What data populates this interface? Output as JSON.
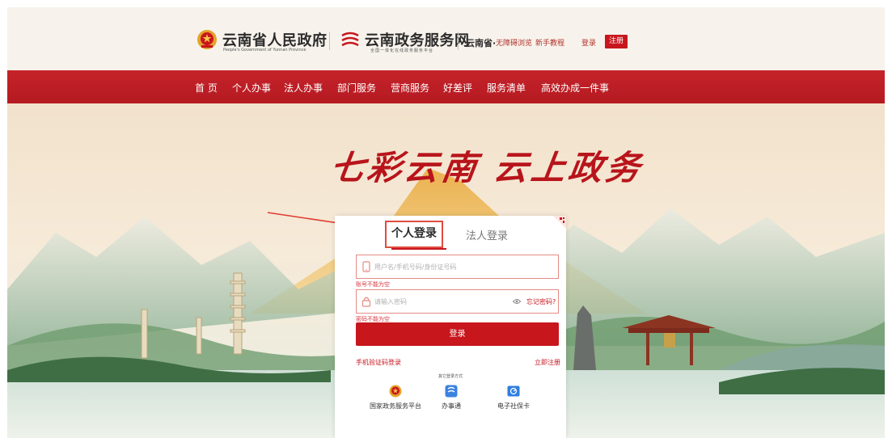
{
  "header": {
    "gov_title": "云南省人民政府",
    "gov_subtitle": "People's Government of Yunnan Province",
    "platform_title": "云南政务服务网",
    "platform_subtitle": "全国一体化在线政务服务平台",
    "region": "云南省·",
    "links": {
      "accessible": "无障碍浏览",
      "guide": "新手教程",
      "login": "登录"
    },
    "register": "注册"
  },
  "nav": {
    "items": [
      "首 页",
      "个人办事",
      "法人办事",
      "部门服务",
      "营商服务",
      "好差评",
      "服务清单",
      "高效办成一件事"
    ]
  },
  "hero": {
    "slogan": "七彩云南 云上政务"
  },
  "login": {
    "tabs": {
      "personal": "个人登录",
      "legal": "法人登录"
    },
    "account": {
      "placeholder": "用户名/手机号码/身份证号码",
      "error": "账号不能为空"
    },
    "password": {
      "placeholder": "请输入密码",
      "error": "密码不能为空",
      "forgot": "忘记密码?"
    },
    "submit": "登录",
    "sms_login": "手机验证码登录",
    "register_now": "立即注册",
    "other_methods_label": "其它登录方式",
    "other_methods": [
      "国家政务服务平台",
      "办事通",
      "电子社保卡"
    ]
  },
  "colors": {
    "primary_red": "#c8161d",
    "nav_red": "#bd1f26",
    "gold": "#e3a32b"
  }
}
